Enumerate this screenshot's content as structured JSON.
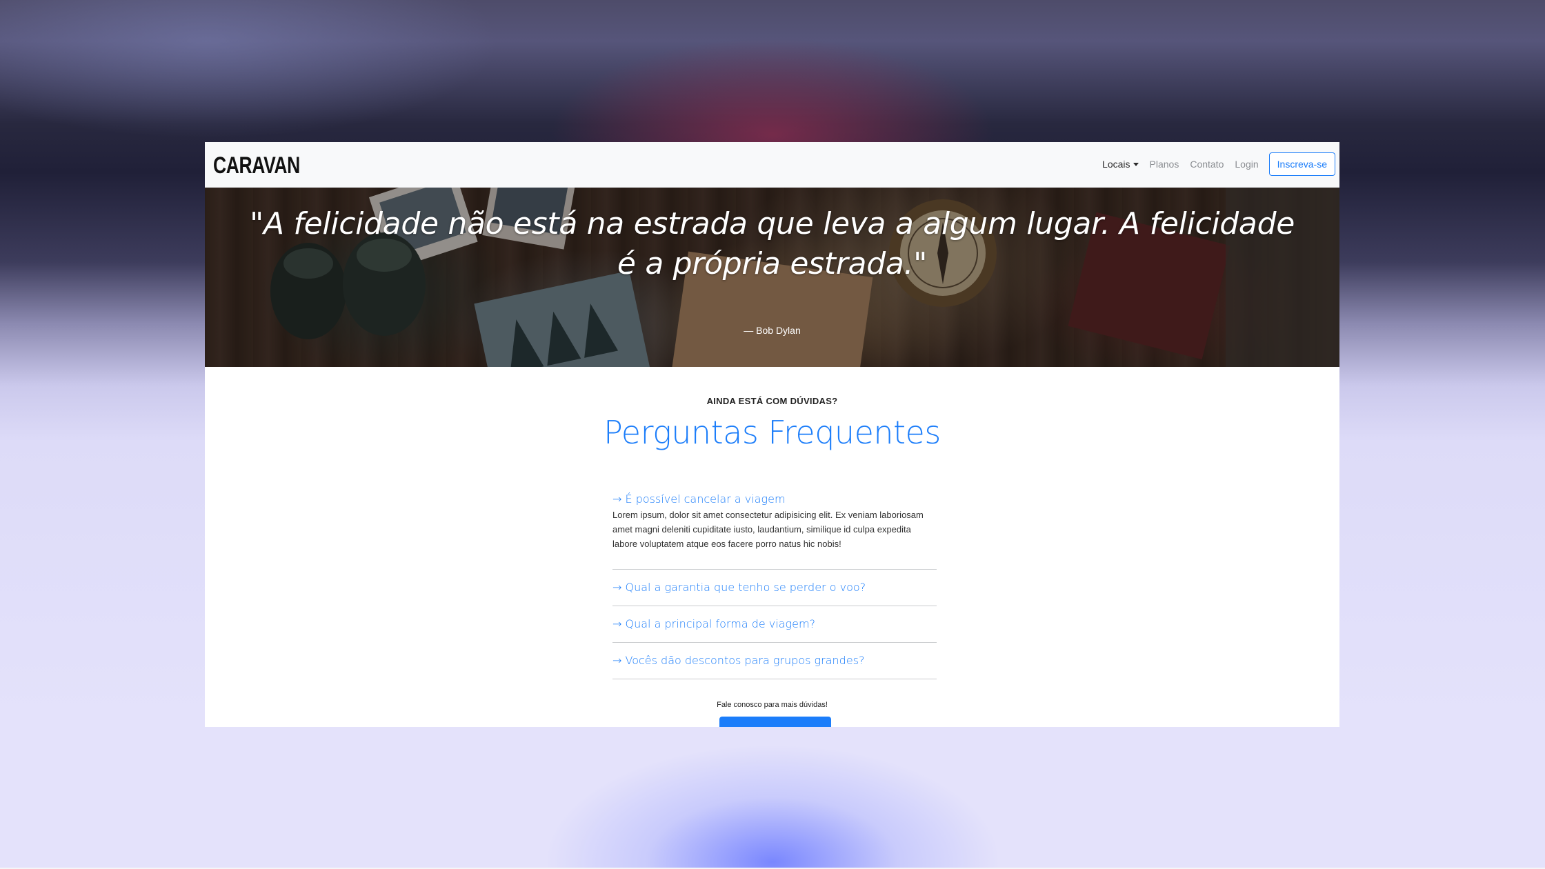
{
  "navbar": {
    "brand": "CARAVAN",
    "links": [
      {
        "label": "Locais"
      },
      {
        "label": "Planos"
      },
      {
        "label": "Contato"
      },
      {
        "label": "Login"
      }
    ],
    "signup_label": "Inscreva-se"
  },
  "hero": {
    "quote": "\"A felicidade não está na estrada que leva a algum lugar. A felicidade é a própria estrada.\"",
    "author": "— Bob Dylan"
  },
  "faq": {
    "eyebrow": "AINDA ESTÁ COM DÚVIDAS?",
    "title": "Perguntas Frequentes",
    "items": [
      {
        "question": "→ É possível cancelar a viagem",
        "answer": "Lorem ipsum, dolor sit amet consectetur adipisicing elit. Ex veniam laboriosam amet magni deleniti cupiditate iusto, laudantium, similique id culpa expedita labore voluptatem atque eos facere porro natus hic nobis!"
      },
      {
        "question": "→ Qual a garantia que tenho se perder o voo?"
      },
      {
        "question": "→ Qual a principal forma de viagem?"
      },
      {
        "question": "→ Vocês dão descontos para grupos grandes?"
      }
    ],
    "note": "Fale conosco para mais dúvidas!"
  },
  "colors": {
    "accent": "#1b7dfa",
    "navbar_bg": "#f8f9fa",
    "text_dark": "#2b2b2b",
    "text_muted": "#8a8d91"
  }
}
